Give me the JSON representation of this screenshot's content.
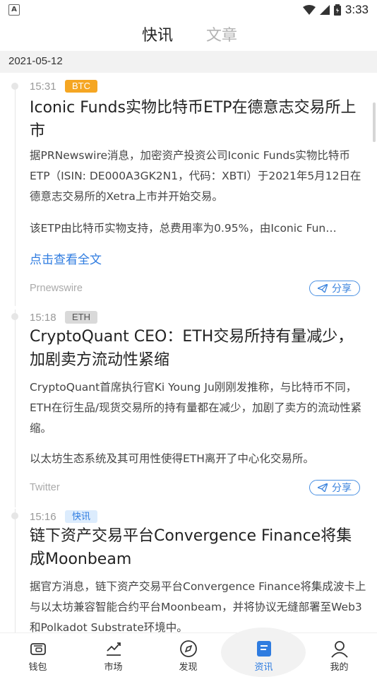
{
  "status_bar": {
    "time": "3:33",
    "left_icon": "A"
  },
  "tabs": [
    {
      "label": "快讯"
    },
    {
      "label": "文章"
    }
  ],
  "date_header": "2021-05-12",
  "items": [
    {
      "time": "15:31",
      "tag": "BTC",
      "tag_color": "#f5a623",
      "title": "Iconic Funds实物比特币ETP在德意志交易所上市",
      "body1": "据PRNewswire消息，加密资产投资公司Iconic Funds实物比特币ETP（ISIN: DE000A3GK2N1，代码：XBTI）于2021年5月12日在德意志交易所的Xetra上市并开始交易。",
      "body2": "该ETP由比特币实物支持，总费用率为0.95%，由Iconic Fun…",
      "read_more": "点击查看全文",
      "source": "Prnewswire",
      "share": "分享"
    },
    {
      "time": "15:18",
      "tag": "ETH",
      "tag_color": "#8a8a8a",
      "title": "CryptoQuant CEO：ETH交易所持有量减少，加剧卖方流动性紧缩",
      "body1": "CryptoQuant首席执行官Ki Young Ju刚刚发推称，与比特币不同，ETH在衍生品/现货交易所的持有量都在减少，加剧了卖方的流动性紧缩。",
      "body2": "以太坊生态系统及其可用性使得ETH离开了中心化交易所。",
      "source": "Twitter",
      "share": "分享"
    },
    {
      "time": "15:16",
      "tag": "快讯",
      "tag_color": "#4a90e2",
      "title": "链下资产交易平台Convergence Finance将集成Moonbeam",
      "body1": "据官方消息，链下资产交易平台Convergence Finance将集成波卡上与以太坊兼容智能合约平台Moonbeam，并将协议无缝部署至Web3和Polkadot Substrate环境中。"
    }
  ],
  "bottom_nav": [
    {
      "label": "钱包",
      "icon": "wallet-icon"
    },
    {
      "label": "市场",
      "icon": "market-chart-icon"
    },
    {
      "label": "发现",
      "icon": "compass-icon"
    },
    {
      "label": "资讯",
      "icon": "news-icon"
    },
    {
      "label": "我的",
      "icon": "profile-icon"
    }
  ],
  "colors": {
    "accent": "#2f7ce0",
    "btc_badge_bg": "#f5a623",
    "eth_badge_bg": "#d9d9d9",
    "news_badge_bg": "#dcecfd"
  }
}
